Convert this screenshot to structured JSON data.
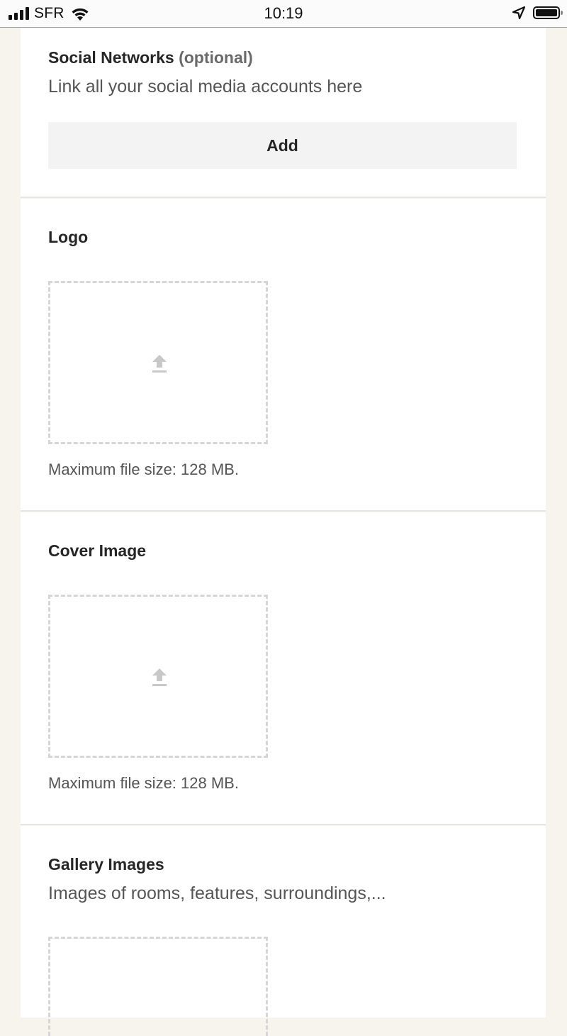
{
  "status_bar": {
    "carrier": "SFR",
    "time": "10:19",
    "icons": [
      "signal-icon",
      "wifi-icon",
      "location-arrow-icon",
      "battery-icon"
    ]
  },
  "social": {
    "label": "Social Networks",
    "optional": "(optional)",
    "helper": "Link all your social media accounts here",
    "add_label": "Add"
  },
  "logo": {
    "label": "Logo",
    "note": "Maximum file size: 128 MB."
  },
  "cover": {
    "label": "Cover Image",
    "note": "Maximum file size: 128 MB."
  },
  "gallery": {
    "label": "Gallery Images",
    "helper": "Images of rooms, features, surroundings,..."
  },
  "colors": {
    "background": "#f6f4ec",
    "card": "#ffffff",
    "button": "#f3f3f3",
    "dashed_border": "#d6d6d6",
    "upload_icon": "#c8c8c8"
  }
}
